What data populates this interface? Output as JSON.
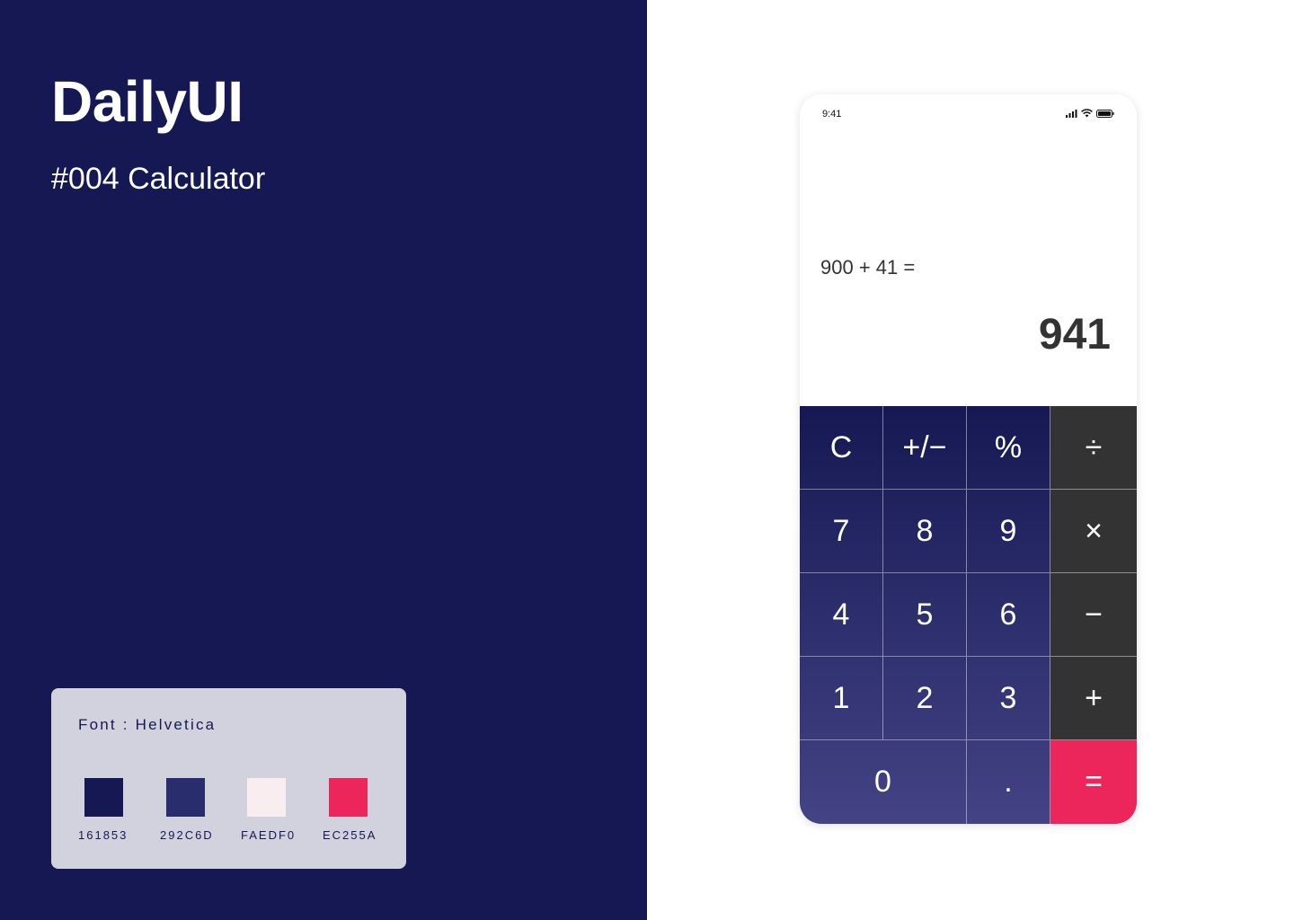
{
  "brand": {
    "title": "DailyUI",
    "subtitle": "#004 Calculator"
  },
  "style_card": {
    "font_label": "Font : Helvetica",
    "swatches": [
      {
        "code": "161853",
        "color": "#161853"
      },
      {
        "code": "292C6D",
        "color": "#292C6D"
      },
      {
        "code": "FAEDF0",
        "color": "#FAEDF0"
      },
      {
        "code": "EC255A",
        "color": "#EC255A"
      }
    ]
  },
  "phone": {
    "status_time": "9:41",
    "status_icons": [
      "signal-icon",
      "wifi-icon",
      "battery-icon"
    ],
    "display": {
      "expression": "900 + 41 =",
      "result": "941"
    },
    "keys": [
      [
        "C",
        "+/−",
        "%",
        "÷"
      ],
      [
        "7",
        "8",
        "9",
        "×"
      ],
      [
        "4",
        "5",
        "6",
        "−"
      ],
      [
        "1",
        "2",
        "3",
        "+"
      ],
      [
        "0",
        ".",
        "="
      ]
    ],
    "colors": {
      "keypad_top": "#161853",
      "keypad_bottom": "#434385",
      "operator": "#333333",
      "equals": "#EC255A"
    }
  }
}
